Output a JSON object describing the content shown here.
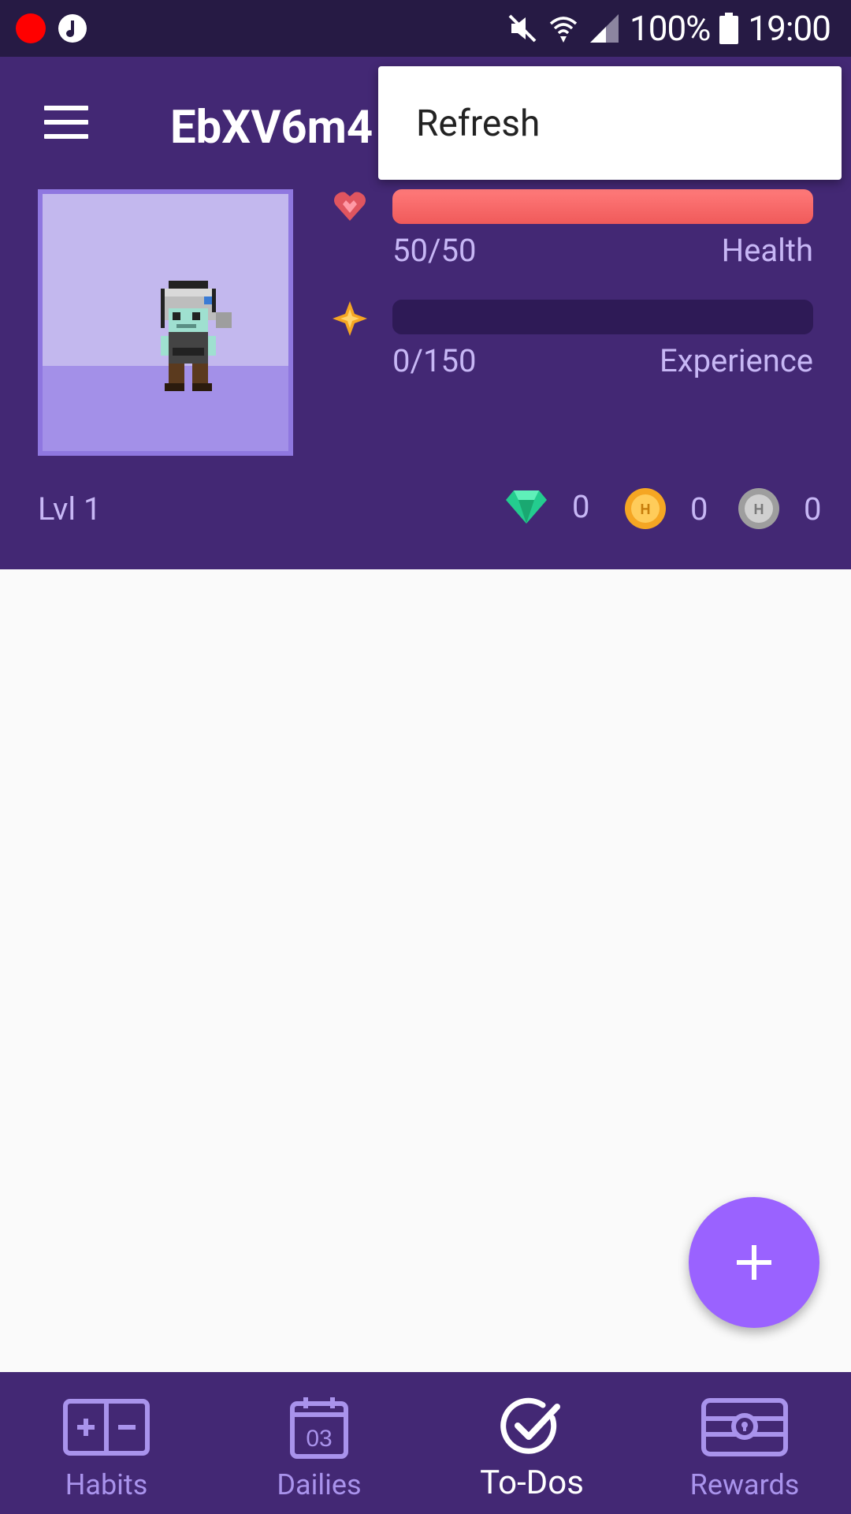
{
  "status_bar": {
    "battery": "100%",
    "time": "19:00",
    "icons": [
      "record-icon",
      "music-icon",
      "mute-icon",
      "wifi-icon",
      "signal-icon",
      "battery-icon"
    ]
  },
  "header": {
    "title": "EbXV6m4",
    "health": {
      "value": "50/50",
      "label": "Health",
      "fill": 1.0
    },
    "experience": {
      "value": "0/150",
      "label": "Experience",
      "fill": 0.0
    },
    "level": "Lvl 1",
    "gems": "0",
    "gold": "0",
    "silver": "0"
  },
  "popup_menu": {
    "items": [
      "Refresh"
    ]
  },
  "fab": {
    "icon": "plus-icon"
  },
  "bottom_nav": {
    "items": [
      {
        "label": "Habits",
        "icon": "habits-icon",
        "active": false
      },
      {
        "label": "Dailies",
        "icon": "calendar-icon",
        "calendar_day": "03",
        "active": false
      },
      {
        "label": "To-Dos",
        "icon": "check-icon",
        "active": true
      },
      {
        "label": "Rewards",
        "icon": "chest-icon",
        "active": false
      }
    ]
  },
  "colors": {
    "header_bg": "#432874",
    "status_bar_bg": "#261a44",
    "health": "#f05a5a",
    "fab": "#9a62ff",
    "nav_inactive": "#a993ec"
  }
}
